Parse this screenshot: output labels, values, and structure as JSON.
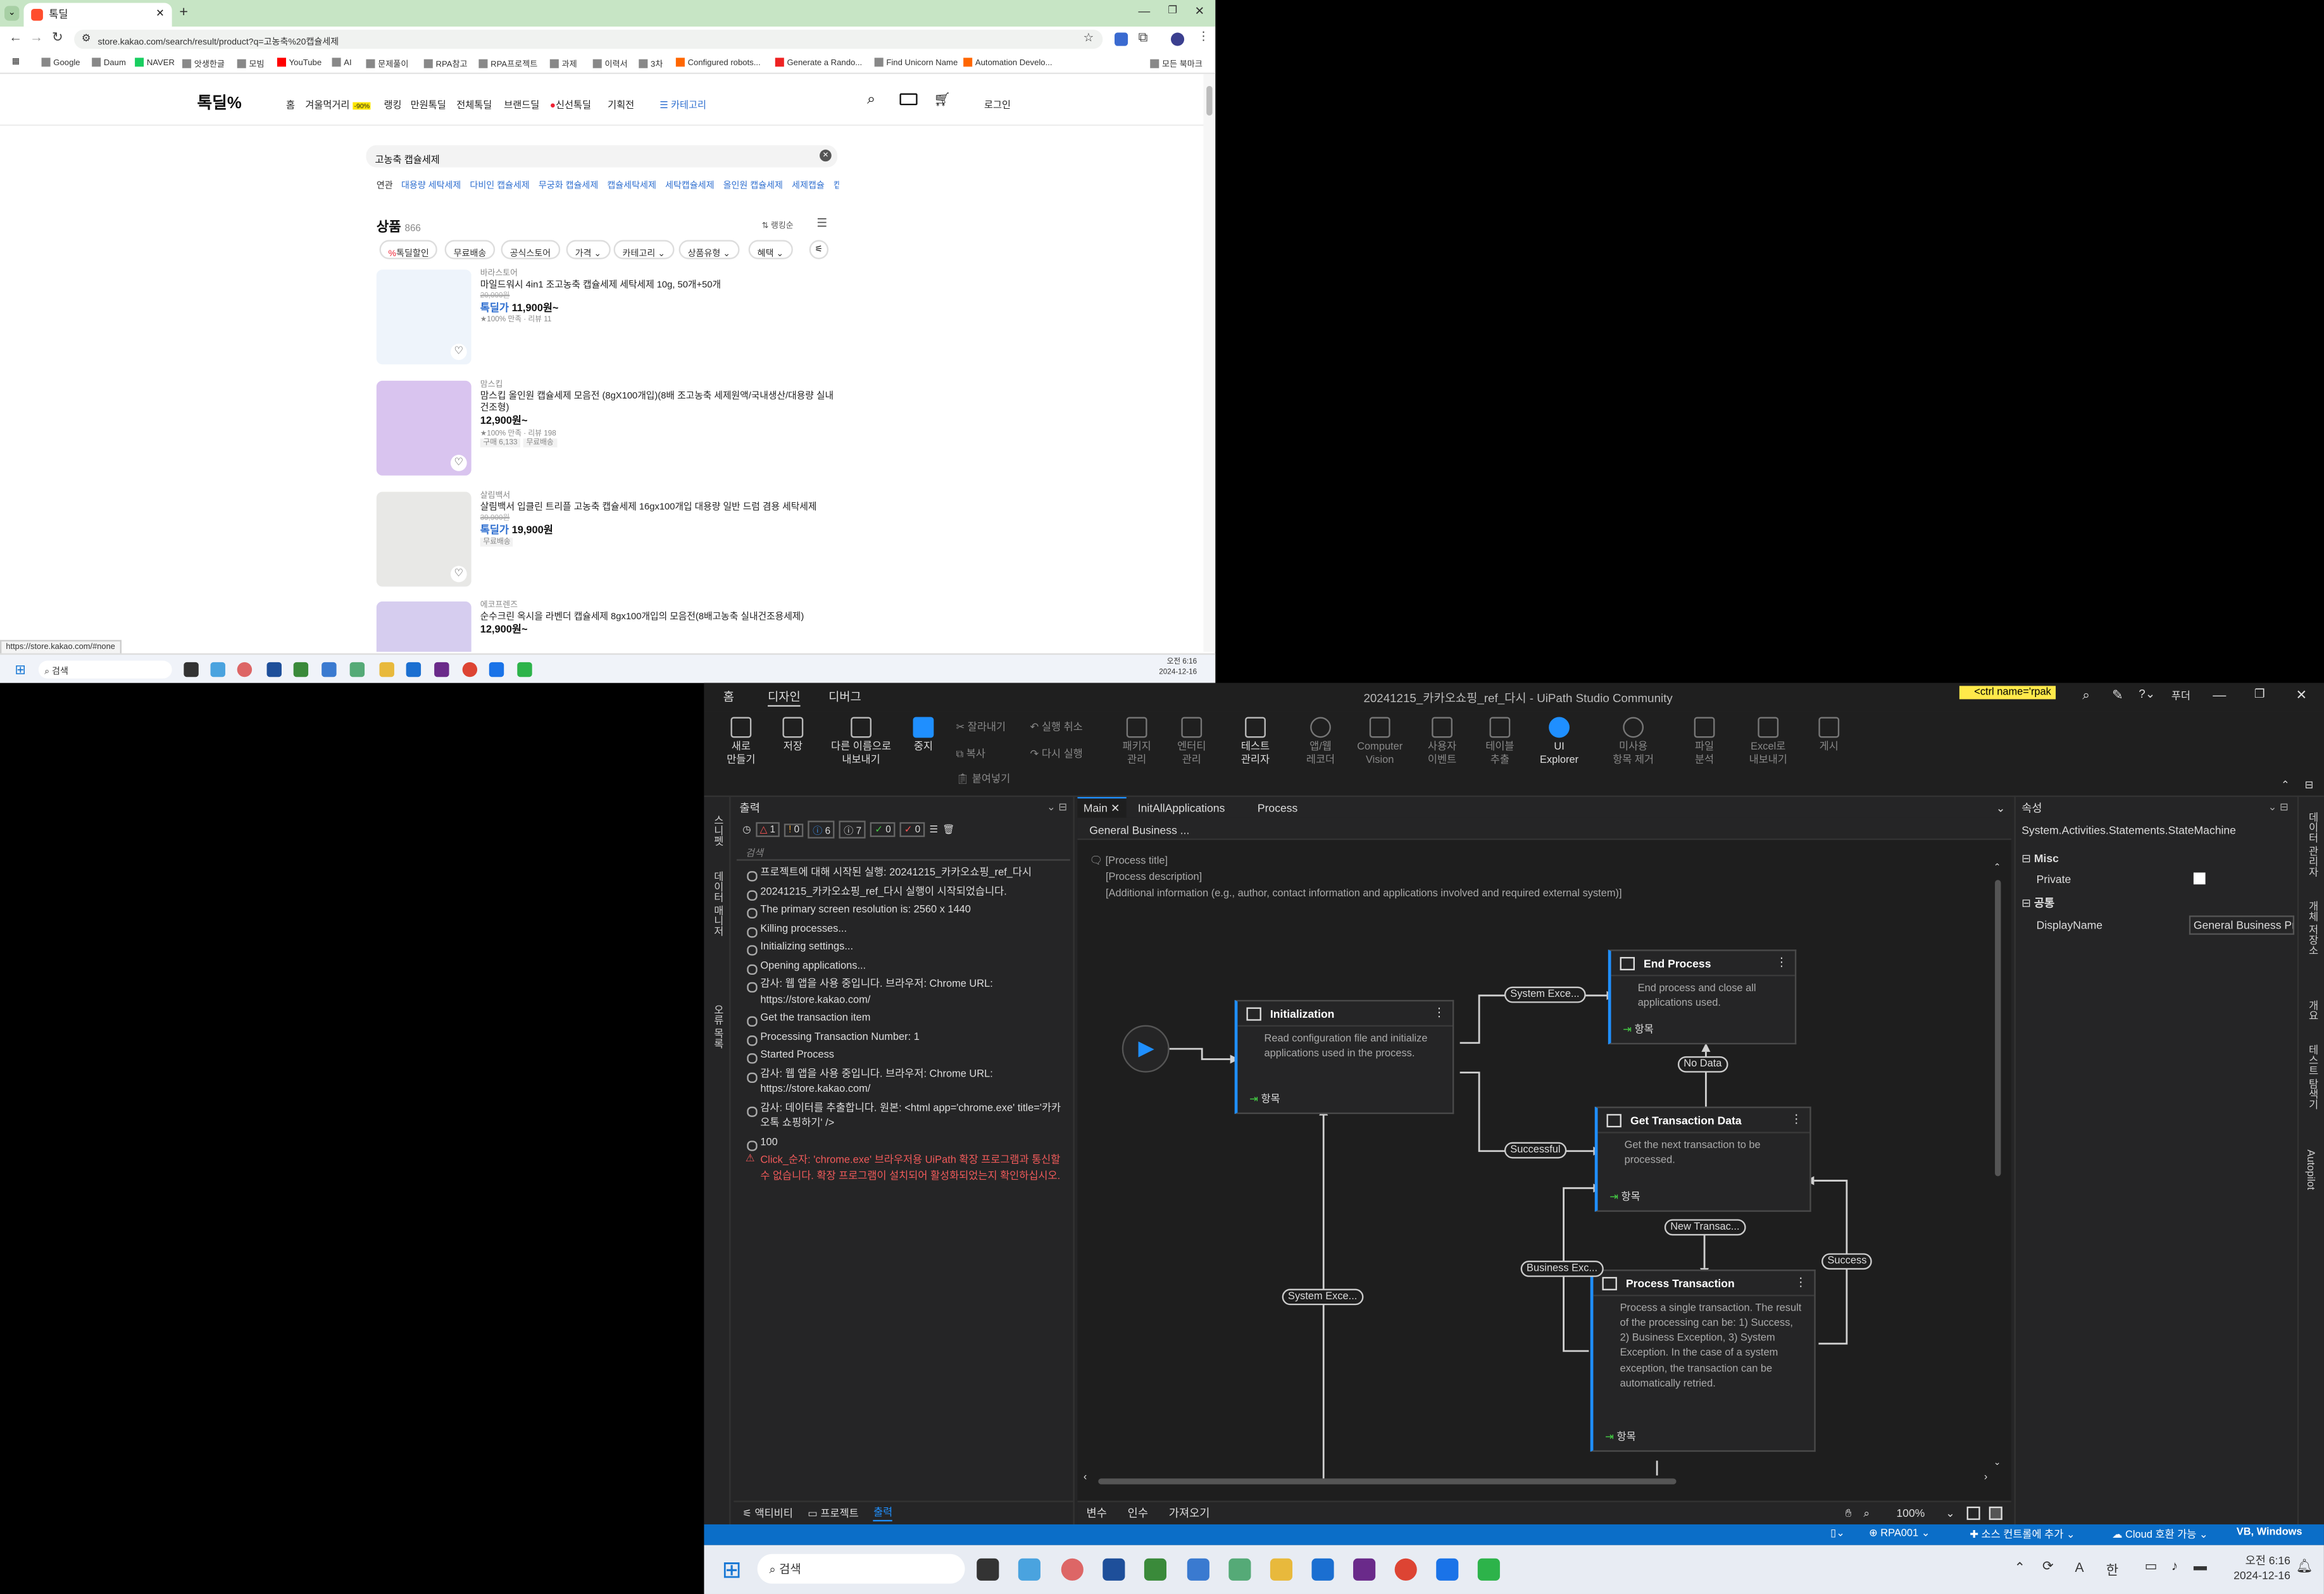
{
  "chrome": {
    "tab_title": "톡딜",
    "url": "store.kakao.com/search/result/product?q=고농축%20캡슐세제",
    "bookmarks": [
      "Google",
      "Daum",
      "NAVER",
      "앗생한글",
      "모빔",
      "YouTube",
      "AI",
      "문제풀이",
      "RPA참고",
      "RPA프로젝트",
      "과제",
      "이력서",
      "3차",
      "Configured robots...",
      "Generate a Rando...",
      "Find Unicorn Name",
      "Automation Develo...",
      "모든 북마크"
    ],
    "status_url": "https://store.kakao.com/#none",
    "clock_time": "오전 6:16",
    "clock_date": "2024-12-16",
    "taskbar_search": "검색"
  },
  "site": {
    "logo": "톡딜%",
    "nav": [
      "홈",
      "겨울먹거리",
      "랭킹",
      "만원톡딜",
      "전체톡딜",
      "브랜드딜",
      "신선톡딜",
      "기획전"
    ],
    "nav_badge": "-90%",
    "category": "☰ 카테고리",
    "login": "로그인",
    "search_value": "고농축 캡슐세제",
    "related_label": "연관",
    "related": [
      "대용량 세탁세제",
      "다비인 캡슐세제",
      "무궁화 캡슐세제",
      "캡슐세탁세제",
      "세탁캡슐세제",
      "올인원 캡슐세제",
      "세제캡슐",
      "캡..."
    ],
    "products_label": "상품",
    "products_count": "866",
    "sort_label": "⇅ 랭킹순",
    "filters": [
      "톡딜할인",
      "무료배송",
      "공식스토어",
      "가격",
      "카테고리",
      "상품유형",
      "혜택"
    ],
    "products": [
      {
        "brand": "바라스토어",
        "name": "마일드워시 4in1 조고농축 캡슐세제 세탁세제 10g, 50개+50개",
        "old": "20,000원",
        "deal": "톡딜가",
        "price": "11,900원~",
        "rating": "★100% 만족 · 리뷰 11",
        "img": "#eef4fb"
      },
      {
        "brand": "맘스킵",
        "name": "맘스킵 올인원 캡슐세제 모음전 (8gX100개입)(8배 조고농축 세제원액/국내생산/대용량 실내건조형)",
        "price": "12,900원~",
        "rating": "★100% 만족 · 리뷰 198",
        "tags": [
          "구매 6,133",
          "무료배송"
        ],
        "img": "#d9c4ef"
      },
      {
        "brand": "살림백서",
        "name": "살림백서 입클린 트리플 고농축 캡슐세제 16gx100개입 대용량 일반 드럼 겸용 세탁세제",
        "old": "39,900원",
        "deal": "톡딜가",
        "price": "19,900원",
        "tags": [
          "무료배송"
        ],
        "img": "#e8e8e6"
      },
      {
        "brand": "에코프렌즈",
        "name": "순수크린 옥시을 라벤더 캡슐세제 8gx100개입의 모음전(8배고농축 실내건조용세제)",
        "price": "12,900원~",
        "img": "#d6cdef"
      }
    ]
  },
  "uipath": {
    "title": "20241215_카카오쇼핑_ref_다시 - UiPath Studio Community",
    "menu_tabs": [
      "홈",
      "디자인",
      "디버그"
    ],
    "search_hint": "<ctrl name='rpak",
    "user_initial": "푸더",
    "ribbon": [
      {
        "label": "새로\n만들기",
        "dim": false
      },
      {
        "label": "저장",
        "dim": false
      },
      {
        "label": "다른 이름으로\n내보내기",
        "dim": false
      },
      {
        "label": "중지",
        "dim": false
      },
      {
        "label": "패키지\n관리",
        "dim": true
      },
      {
        "label": "엔터티\n관리",
        "dim": true
      },
      {
        "label": "테스트\n관리자",
        "dim": false
      },
      {
        "label": "앱/웹\n레코더",
        "dim": true
      },
      {
        "label": "Computer\nVision",
        "dim": true
      },
      {
        "label": "사용자\n이벤트",
        "dim": true
      },
      {
        "label": "테이블\n추출",
        "dim": true
      },
      {
        "label": "UI\nExplorer",
        "dim": false
      },
      {
        "label": "미사용\n항목 제거",
        "dim": true
      },
      {
        "label": "파일\n분석",
        "dim": true
      },
      {
        "label": "Excel로\n내보내기",
        "dim": true
      },
      {
        "label": "게시",
        "dim": true
      }
    ],
    "ribbon_small": [
      "잘라내기",
      "복사",
      "붙여넣기",
      "실행 취소",
      "다시 실행"
    ],
    "left_strip": [
      "스니펫",
      "데이터 매니저",
      "오류 목록"
    ],
    "right_strip": [
      "데이터 관리자",
      "개체 저장소",
      "개요",
      "테스트 탐색기",
      "Autopilot"
    ],
    "output": {
      "title": "출력",
      "counters": [
        "1",
        "0",
        "6",
        "7",
        "0",
        "0"
      ],
      "search_placeholder": "검색",
      "lines": [
        {
          "t": "프로젝트에 대해 시작된 실행: 20241215_카카오쇼핑_ref_다시",
          "err": false
        },
        {
          "t": "20241215_카카오쇼핑_ref_다시 실행이 시작되었습니다.",
          "err": false
        },
        {
          "t": "The primary screen resolution is: 2560 x 1440",
          "err": false
        },
        {
          "t": "Killing processes...",
          "err": false
        },
        {
          "t": "Initializing settings...",
          "err": false
        },
        {
          "t": "Opening applications...",
          "err": false
        },
        {
          "t": "감사: 웹 앱을 사용 중입니다. 브라우저: Chrome URL: https://store.kakao.com/",
          "err": false
        },
        {
          "t": "Get the transaction item",
          "err": false
        },
        {
          "t": "Processing Transaction Number: 1",
          "err": false
        },
        {
          "t": "Started Process",
          "err": false
        },
        {
          "t": "감사: 웹 앱을 사용 중입니다. 브라우저: Chrome URL: https://store.kakao.com/",
          "err": false
        },
        {
          "t": "감사: 데이터를 추출합니다. 원본: <html app='chrome.exe' title='카카오톡 쇼핑하기' />",
          "err": false
        },
        {
          "t": "100",
          "err": false
        },
        {
          "t": "Click_순자: 'chrome.exe' 브라우저용 UiPath 확장 프로그램과 통신할 수 없습니다. 확장 프로그램이 설치되어 활성화되었는지 확인하십시오.",
          "err": true
        }
      ],
      "bottom_tabs": [
        "액티비티",
        "프로젝트",
        "출력"
      ]
    },
    "designer": {
      "tabs": [
        "Main",
        "InitAllApplications",
        "Process"
      ],
      "breadcrumb": "General Business ...",
      "annotation": [
        "[Process title]",
        "[Process description]",
        "[Additional information (e.g., author, contact information and applications involved and required external system)]"
      ],
      "states": [
        {
          "title": "Initialization",
          "desc": "Read configuration file and initialize applications used in the process.",
          "footer": "항목"
        },
        {
          "title": "End Process",
          "desc": "End process and close all applications used.",
          "footer": "항목"
        },
        {
          "title": "Get Transaction Data",
          "desc": "Get the next transaction to be processed.",
          "footer": "항목"
        },
        {
          "title": "Process Transaction",
          "desc": "Process a single transaction. The result of the processing can be: 1) Success, 2) Business Exception, 3) System Exception. In the case of a system exception, the transaction can be automatically retried.",
          "footer": "항목"
        }
      ],
      "transitions": [
        "System Exce...",
        "Successful",
        "No Data",
        "New Transac...",
        "Business Exc...",
        "Success",
        "System Exce..."
      ],
      "bottom_tabs": [
        "변수",
        "인수",
        "가져오기"
      ],
      "zoom": "100%"
    },
    "properties": {
      "title": "속성",
      "type": "System.Activities.Statements.StateMachine",
      "group_misc": "Misc",
      "private_label": "Private",
      "group_common": "공통",
      "display_name_label": "DisplayName",
      "display_name_value": "General Business Pr"
    },
    "statusbar": {
      "robot": "RPA001",
      "source": "소스 컨트롤에 추가",
      "cloud": "Cloud 호환 가능",
      "lang": "VB, Windows"
    },
    "taskbar": {
      "search": "검색",
      "time": "오전 6:16",
      "date": "2024-12-16",
      "ime": "한",
      "ime2": "A"
    }
  }
}
